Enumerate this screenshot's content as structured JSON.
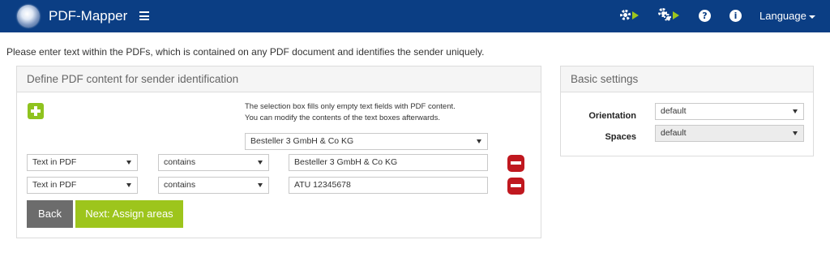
{
  "navbar": {
    "title": "PDF-Mapper",
    "language_label": "Language",
    "icons": [
      "logo-icon",
      "menu-icon",
      "gear-play-icon",
      "gears-play-icon",
      "help-icon",
      "info-icon"
    ],
    "help_glyph": "?",
    "info_glyph": "i"
  },
  "intro_text": "Please enter text within the PDFs, which is contained on any PDF document and identifies the sender uniquely.",
  "content_panel": {
    "title": "Define PDF content for sender identification",
    "hint_line1": "The selection box fills only empty text fields with PDF content.",
    "hint_line2": "You can modify the contents of the text boxes afterwards.",
    "content_select": "Besteller 3 GmbH & Co KG",
    "rows": [
      {
        "field": "Text in PDF",
        "operator": "contains",
        "value": "Besteller 3 GmbH & Co KG"
      },
      {
        "field": "Text in PDF",
        "operator": "contains",
        "value": "ATU 12345678"
      }
    ],
    "back_label": "Back",
    "next_label": "Next: Assign areas"
  },
  "settings_panel": {
    "title": "Basic settings",
    "orientation_label": "Orientation",
    "orientation_value": "default",
    "spaces_label": "Spaces",
    "spaces_value": "default"
  },
  "colors": {
    "navbar": "#0b3e84",
    "accent_green": "#9dc51c",
    "remove_red": "#c0181f",
    "back_gray": "#6c6c6c"
  }
}
